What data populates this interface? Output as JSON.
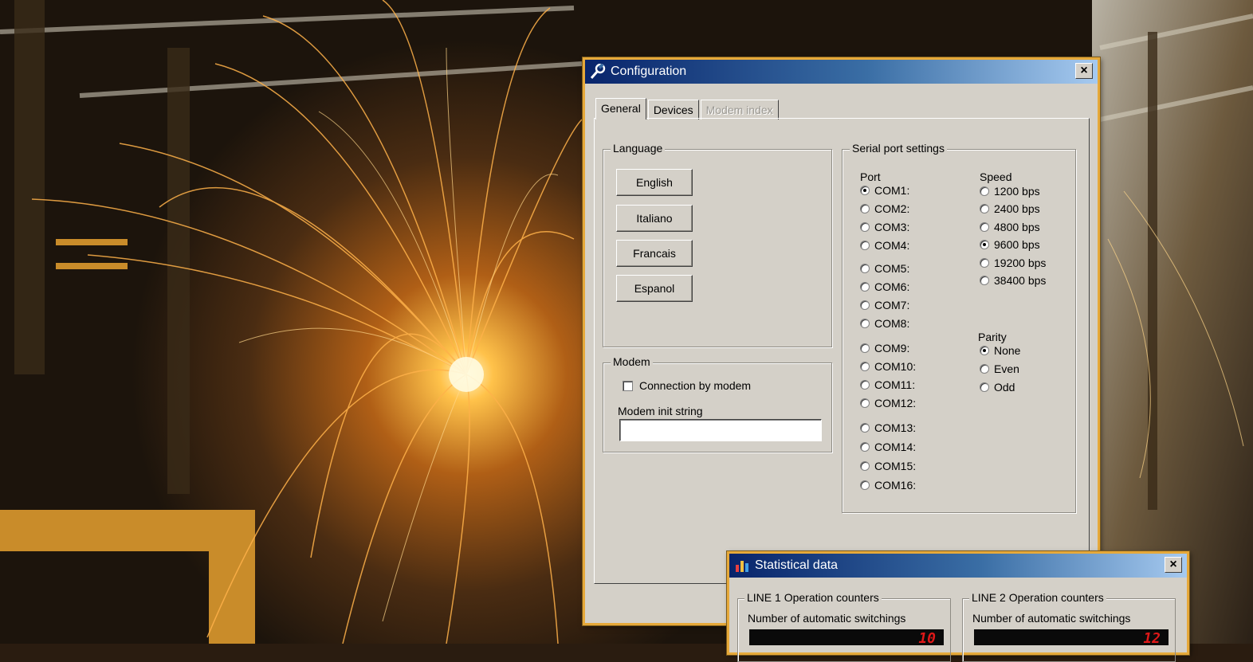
{
  "config_window": {
    "title": "Configuration",
    "close_label": "×",
    "tabs": [
      {
        "label": "General",
        "state": "active"
      },
      {
        "label": "Devices",
        "state": "normal"
      },
      {
        "label": "Modem index",
        "state": "disabled"
      }
    ],
    "language": {
      "legend": "Language",
      "buttons": [
        "English",
        "Italiano",
        "Francais",
        "Espanol"
      ]
    },
    "modem": {
      "legend": "Modem",
      "checkbox_label": "Connection by modem",
      "checkbox_checked": false,
      "init_label": "Modem init string",
      "init_value": ""
    },
    "serial": {
      "legend": "Serial port settings",
      "port_label": "Port",
      "ports": [
        "COM1:",
        "COM2:",
        "COM3:",
        "COM4:",
        "COM5:",
        "COM6:",
        "COM7:",
        "COM8:",
        "COM9:",
        "COM10:",
        "COM11:",
        "COM12:",
        "COM13:",
        "COM14:",
        "COM15:",
        "COM16:"
      ],
      "selected_port": "COM1:",
      "speed_label": "Speed",
      "speeds": [
        "1200 bps",
        "2400 bps",
        "4800 bps",
        "9600 bps",
        "19200 bps",
        "38400 bps"
      ],
      "selected_speed": "9600 bps",
      "parity_label": "Parity",
      "parities": [
        "None",
        "Even",
        "Odd"
      ],
      "selected_parity": "None"
    }
  },
  "stat_window": {
    "title": "Statistical data",
    "close_label": "×",
    "line1": {
      "legend": "LINE 1 Operation counters",
      "counter_label": "Number of automatic switchings",
      "value": "10"
    },
    "line2": {
      "legend": "LINE 2 Operation counters",
      "counter_label": "Number of automatic switchings",
      "value": "12"
    }
  },
  "icons": {
    "config": "wrench-icon",
    "stats": "chart-icon"
  }
}
